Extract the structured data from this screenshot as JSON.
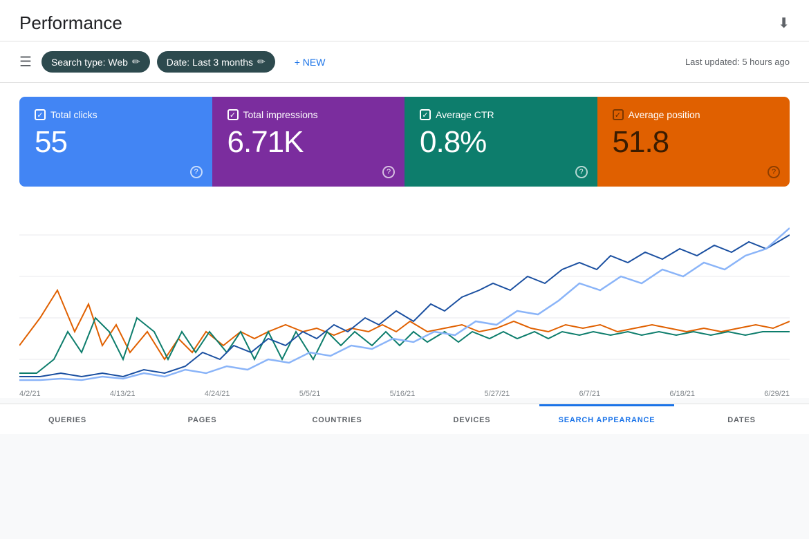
{
  "header": {
    "title": "Performance",
    "download_tooltip": "Download"
  },
  "toolbar": {
    "search_type_label": "Search type: Web",
    "date_label": "Date: Last 3 months",
    "new_label": "+ NEW",
    "last_updated": "Last updated: 5 hours ago"
  },
  "metrics": [
    {
      "id": "total-clicks",
      "label": "Total clicks",
      "value": "55",
      "color": "blue"
    },
    {
      "id": "total-impressions",
      "label": "Total impressions",
      "value": "6.71K",
      "color": "purple"
    },
    {
      "id": "average-ctr",
      "label": "Average CTR",
      "value": "0.8%",
      "color": "teal"
    },
    {
      "id": "average-position",
      "label": "Average position",
      "value": "51.8",
      "color": "orange"
    }
  ],
  "chart": {
    "x_labels": [
      "4/2/21",
      "4/13/21",
      "4/24/21",
      "5/5/21",
      "5/16/21",
      "5/27/21",
      "6/7/21",
      "6/18/21",
      "6/29/21"
    ]
  },
  "tabs": [
    {
      "label": "QUERIES",
      "active": false
    },
    {
      "label": "PAGES",
      "active": false
    },
    {
      "label": "COUNTRIES",
      "active": false
    },
    {
      "label": "DEVICES",
      "active": false
    },
    {
      "label": "SEARCH APPEARANCE",
      "active": true
    },
    {
      "label": "DATES",
      "active": false
    }
  ]
}
